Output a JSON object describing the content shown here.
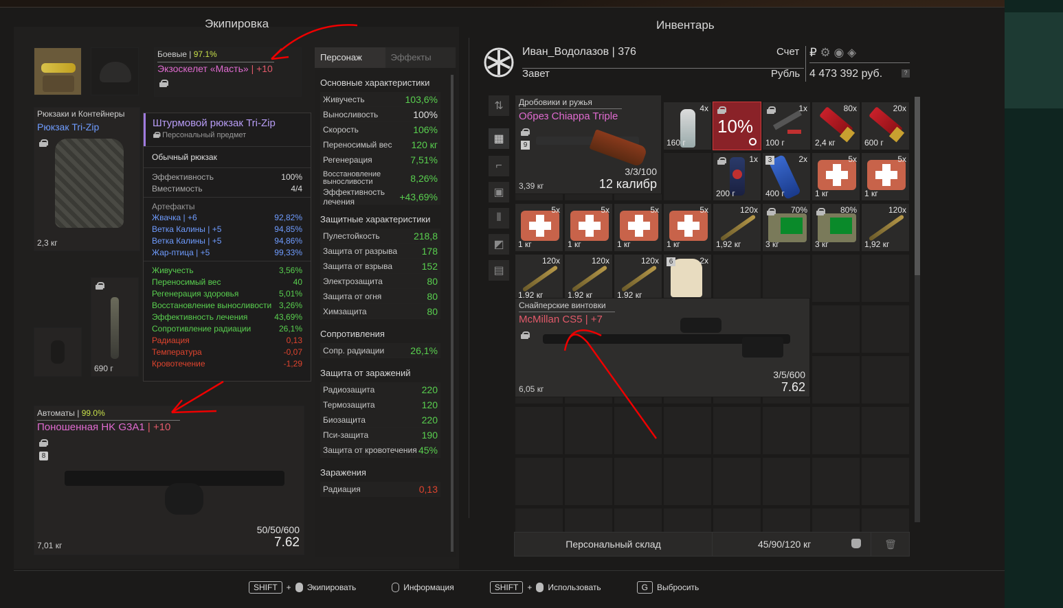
{
  "colors": {
    "accent_pink": "#e06bd0",
    "accent_red": "#e25a6a",
    "stat_green": "#59d04f",
    "warn_red": "#e0442e",
    "blue": "#6f9cff"
  },
  "equipment": {
    "title": "Экипировка",
    "armor": {
      "category": "Боевые",
      "durability": "97.1%",
      "name": "Экзоскелет «Масть»",
      "upgrade": "+10"
    },
    "backpack": {
      "category": "Рюкзаки и Контейнеры",
      "name": "Рюкзак Tri-Zip",
      "weight": "2,3 кг"
    },
    "melee_weight": "690 г",
    "rifle": {
      "category": "Автоматы",
      "durability": "99.0%",
      "name": "Поношенная HK G3A1",
      "upgrade": "+10",
      "badge": "8",
      "ammo": "50/50/600",
      "caliber": "7.62",
      "weight": "7,01 кг"
    }
  },
  "tooltip": {
    "name": "Штурмовой рюкзак Tri-Zip",
    "personal": "Персональный предмет",
    "type": "Обычный рюкзак",
    "base": [
      {
        "k": "Эффективность",
        "v": "100%"
      },
      {
        "k": "Вместимость",
        "v": "4/4"
      }
    ],
    "artifacts_title": "Артефакты",
    "artifacts": [
      {
        "k": "Жвачка | +6",
        "v": "92,82%"
      },
      {
        "k": "Ветка Калины | +5",
        "v": "94,85%"
      },
      {
        "k": "Ветка Калины | +5",
        "v": "94,86%"
      },
      {
        "k": "Жар-птица | +5",
        "v": "99,33%"
      }
    ],
    "bonuses": [
      {
        "k": "Живучесть",
        "v": "3,56%"
      },
      {
        "k": "Переносимый вес",
        "v": "40"
      },
      {
        "k": "Регенерация здоровья",
        "v": "5,01%"
      },
      {
        "k": "Восстановление выносливости",
        "v": "3,26%"
      },
      {
        "k": "Эффективность лечения",
        "v": "43,69%"
      },
      {
        "k": "Сопротивление радиации",
        "v": "26,1%"
      }
    ],
    "negatives": [
      {
        "k": "Радиация",
        "v": "0,13"
      },
      {
        "k": "Температура",
        "v": "-0,07"
      },
      {
        "k": "Кровотечение",
        "v": "-1,29"
      }
    ]
  },
  "stats": {
    "tabs": [
      "Персонаж",
      "Эффекты"
    ],
    "main_title": "Основные характеристики",
    "main": [
      {
        "k": "Живучесть",
        "v": "103,6%"
      },
      {
        "k": "Выносливость",
        "v": "100%"
      },
      {
        "k": "Скорость",
        "v": "106%"
      },
      {
        "k": "Переносимый вес",
        "v": "120 кг"
      },
      {
        "k": "Регенерация",
        "v": "7,51%"
      },
      {
        "k": "Восстановление выносливости",
        "v": "8,26%"
      },
      {
        "k": "Эффективность лечения",
        "v": "+43,69%"
      }
    ],
    "def_title": "Защитные характеристики",
    "def": [
      {
        "k": "Пулестойкость",
        "v": "218,8"
      },
      {
        "k": "Защита от разрыва",
        "v": "178"
      },
      {
        "k": "Защита от взрыва",
        "v": "152"
      },
      {
        "k": "Электрозащита",
        "v": "80"
      },
      {
        "k": "Защита от огня",
        "v": "80"
      },
      {
        "k": "Химзащита",
        "v": "80"
      }
    ],
    "res_title": "Сопротивления",
    "res": [
      {
        "k": "Сопр. радиации",
        "v": "26,1%"
      }
    ],
    "inf_title": "Защита от заражений",
    "inf": [
      {
        "k": "Радиозащита",
        "v": "220"
      },
      {
        "k": "Термозащита",
        "v": "120"
      },
      {
        "k": "Биозащита",
        "v": "220"
      },
      {
        "k": "Пси-защита",
        "v": "190"
      },
      {
        "k": "Защита от кровотечения",
        "v": "45%"
      }
    ],
    "cont_title": "Заражения",
    "cont": [
      {
        "k": "Радиация",
        "v": "0,13"
      }
    ]
  },
  "inventory": {
    "title": "Инвентарь",
    "player": "Иван_Водолазов | 376",
    "faction": "Завет",
    "account_label": "Счет",
    "currency_label": "Рубль",
    "money": "4 473 392 руб.",
    "shotgun": {
      "category": "Дробовики и ружья",
      "name": "Обрез Chiappa Triple",
      "badge": "9",
      "ammo": "3/3/100",
      "caliber": "12 калибр",
      "weight": "3,39 кг"
    },
    "sniper": {
      "category": "Снайперские винтовки",
      "name": "McMillan CS5",
      "upgrade": "+7",
      "ammo": "3/5/600",
      "caliber": "7.62",
      "weight": "6,05 кг"
    },
    "items": [
      {
        "q": "4x",
        "wt": "160 г",
        "kind": "bottle"
      },
      {
        "q": "",
        "wt": "",
        "kind": "pct",
        "pct": "10%"
      },
      {
        "q": "1x",
        "wt": "100 г",
        "kind": "tool"
      },
      {
        "q": "80x",
        "wt": "2,4 кг",
        "kind": "shell"
      },
      {
        "q": "20x",
        "wt": "600 г",
        "kind": "shell"
      },
      {
        "q": "1x",
        "wt": "200 г",
        "kind": "spray"
      },
      {
        "q": "2x",
        "wt": "400 г",
        "kind": "blue",
        "badge": "3"
      },
      {
        "q": "5x",
        "wt": "1 кг",
        "kind": "medkit"
      },
      {
        "q": "5x",
        "wt": "1 кг",
        "kind": "medkit"
      },
      {
        "q": "5x",
        "wt": "1 кг",
        "kind": "medkit"
      },
      {
        "q": "5x",
        "wt": "1 кг",
        "kind": "medkit"
      },
      {
        "q": "5x",
        "wt": "1 кг",
        "kind": "medkit"
      },
      {
        "q": "5x",
        "wt": "1 кг",
        "kind": "medkit"
      },
      {
        "q": "120x",
        "wt": "1,92 кг",
        "kind": "bullet"
      },
      {
        "q": "70%",
        "wt": "3 кг",
        "kind": "device"
      },
      {
        "q": "80%",
        "wt": "3 кг",
        "kind": "device"
      },
      {
        "q": "120x",
        "wt": "1,92 кг",
        "kind": "bullet"
      },
      {
        "q": "120x",
        "wt": "1,92 кг",
        "kind": "bullet"
      },
      {
        "q": "120x",
        "wt": "1,92 кг",
        "kind": "bullet"
      },
      {
        "q": "120x",
        "wt": "1,92 кг",
        "kind": "bullet"
      },
      {
        "q": "2x",
        "wt": "",
        "kind": "bread",
        "badge": "6"
      }
    ],
    "storage_label": "Персональный склад",
    "capacity": "45/90/120 кг"
  },
  "footer": {
    "shift": "SHIFT",
    "equip": "Экипировать",
    "info": "Информация",
    "use": "Использовать",
    "g": "G",
    "drop": "Выбросить"
  },
  "icons": [
    "lock-icon",
    "sort-icon",
    "grid-icon",
    "rifle-filter-icon",
    "armor-filter-icon",
    "ammo-filter-icon",
    "artifact-filter-icon",
    "trash-icon",
    "weight-icon",
    "emblem-icon"
  ]
}
